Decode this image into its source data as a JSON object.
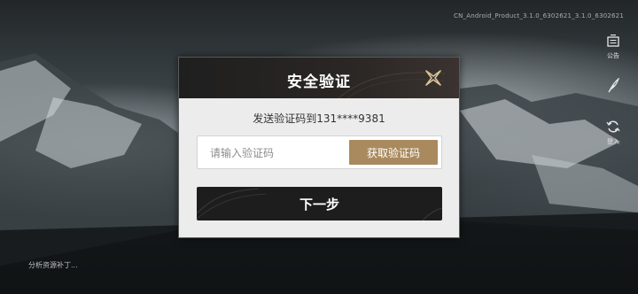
{
  "build_version": "CN_Android_Product_3.1.0_6302621_3.1.0_6302621",
  "side_buttons": {
    "notice_label": "公告",
    "login_label": "登入"
  },
  "status_text": "分析资源补丁...",
  "dialog": {
    "title": "安全验证",
    "subtitle": "发送验证码到131****9381",
    "code_placeholder": "请输入验证码",
    "get_code_label": "获取验证码",
    "next_label": "下一步"
  },
  "colors": {
    "accent_gold": "#a98a5e",
    "header_dark": "#1f1f1f",
    "dialog_bg": "#ececec"
  },
  "icons": [
    "notice-icon",
    "feather-icon",
    "refresh-icon",
    "close-icon"
  ]
}
